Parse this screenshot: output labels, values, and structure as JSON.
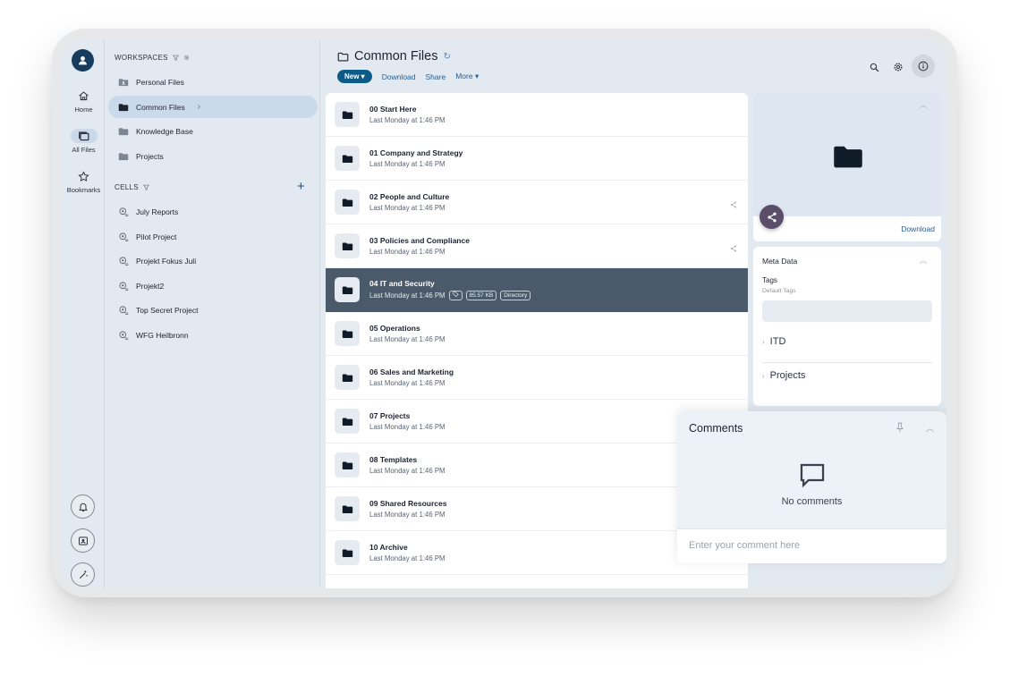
{
  "app": {
    "rail": {
      "home_label": "Home",
      "all_files_label": "All Files",
      "bookmarks_label": "Bookmarks"
    },
    "sidebar": {
      "workspaces_title": "WORKSPACES",
      "workspaces": [
        {
          "label": "Personal Files"
        },
        {
          "label": "Common Files"
        },
        {
          "label": "Knowledge Base"
        },
        {
          "label": "Projects"
        }
      ],
      "cells_title": "CELLS",
      "cells": [
        {
          "label": "July Reports"
        },
        {
          "label": "Pilot Project"
        },
        {
          "label": "Projekt Fokus Juli"
        },
        {
          "label": "Projekt2"
        },
        {
          "label": "Top Secret Project"
        },
        {
          "label": "WFG Heilbronn"
        }
      ]
    },
    "header": {
      "title": "Common Files",
      "new_label": "New",
      "download_label": "Download",
      "share_label": "Share",
      "more_label": "More"
    },
    "files": [
      {
        "name": "00 Start Here",
        "modified": "Last Monday at 1:46 PM"
      },
      {
        "name": "01 Company and Strategy",
        "modified": "Last Monday at 1:46 PM"
      },
      {
        "name": "02 People and Culture",
        "modified": "Last Monday at 1:46 PM"
      },
      {
        "name": "03 Policies and Compliance",
        "modified": "Last Monday at 1:46 PM"
      },
      {
        "name": "04 IT and Security",
        "modified": "Last Monday at 1:46 PM",
        "size": "85.57 KB",
        "kind": "Directory"
      },
      {
        "name": "05 Operations",
        "modified": "Last Monday at 1:46 PM"
      },
      {
        "name": "06 Sales and Marketing",
        "modified": "Last Monday at 1:46 PM"
      },
      {
        "name": "07 Projects",
        "modified": "Last Monday at 1:46 PM"
      },
      {
        "name": "08 Templates",
        "modified": "Last Monday at 1:46 PM"
      },
      {
        "name": "09 Shared Resources",
        "modified": "Last Monday at 1:46 PM"
      },
      {
        "name": "10 Archive",
        "modified": "Last Monday at 1:46 PM"
      }
    ],
    "preview": {
      "download_label": "Download"
    },
    "meta": {
      "title": "Meta Data",
      "tags_label": "Tags",
      "tags_sub": "Default Tags",
      "groups": [
        {
          "label": "ITD"
        },
        {
          "label": "Projects"
        }
      ]
    },
    "comments": {
      "title": "Comments",
      "empty": "No comments",
      "placeholder": "Enter your comment here"
    },
    "colors": {
      "accent": "#0d5c87",
      "selected_row": "#4a5a6a",
      "share_button": "#5b4e6a"
    }
  }
}
